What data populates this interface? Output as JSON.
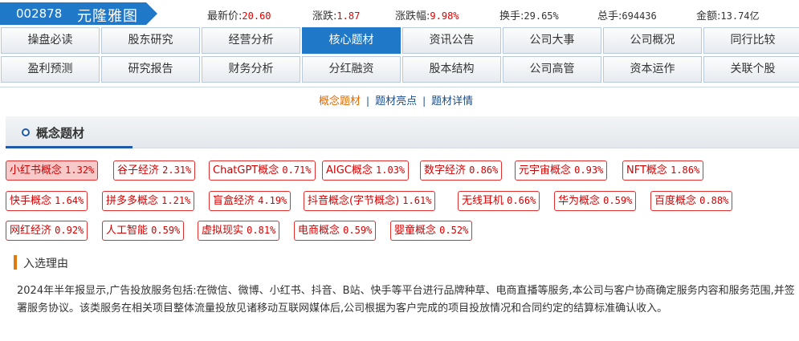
{
  "header": {
    "stock_code": "002878",
    "stock_name": "元隆雅图",
    "quotes": [
      {
        "label": "最新价:",
        "value": "20.60",
        "red": true
      },
      {
        "label": "涨跌:",
        "value": "1.87",
        "red": true
      },
      {
        "label": "涨跌幅:",
        "value": "9.98%",
        "red": true
      },
      {
        "label": "换手:",
        "value": "29.65%",
        "red": false
      },
      {
        "label": "总手:",
        "value": "694436",
        "red": false
      },
      {
        "label": "金额:",
        "value": "13.74亿",
        "red": false
      }
    ]
  },
  "nav": {
    "row1": [
      "操盘必读",
      "股东研究",
      "经营分析",
      "核心题材",
      "资讯公告",
      "公司大事",
      "公司概况",
      "同行比较"
    ],
    "row2": [
      "盈利预测",
      "研究报告",
      "财务分析",
      "分红融资",
      "股本结构",
      "公司高管",
      "资本运作",
      "关联个股"
    ],
    "active": "核心题材"
  },
  "subtabs": [
    "概念题材",
    "题材亮点",
    "题材详情"
  ],
  "subtab_sep": "|",
  "section": {
    "title": "概念题材"
  },
  "tags": [
    {
      "name": "小红书概念",
      "value": "1.32%",
      "active": true
    },
    {
      "name": "谷子经济",
      "value": "2.31%"
    },
    {
      "name": "ChatGPT概念",
      "value": "0.71%"
    },
    {
      "name": "AIGC概念",
      "value": "1.03%"
    },
    {
      "name": "数字经济",
      "value": "0.86%"
    },
    {
      "name": "元宇宙概念",
      "value": "0.93%"
    },
    {
      "name": "NFT概念",
      "value": "1.86%"
    },
    {
      "name": "快手概念",
      "value": "1.64%"
    },
    {
      "name": "拼多多概念",
      "value": "1.21%"
    },
    {
      "name": "盲盒经济",
      "value": "4.19%"
    },
    {
      "name": "抖音概念(字节概念)",
      "value": "1.61%"
    },
    {
      "name": "无线耳机",
      "value": "0.66%"
    },
    {
      "name": "华为概念",
      "value": "0.59%"
    },
    {
      "name": "百度概念",
      "value": "0.88%"
    },
    {
      "name": "网红经济",
      "value": "0.92%"
    },
    {
      "name": "人工智能",
      "value": "0.59%"
    },
    {
      "name": "虚拟现实",
      "value": "0.81%"
    },
    {
      "name": "电商概念",
      "value": "0.59%"
    },
    {
      "name": "婴童概念",
      "value": "0.52%"
    }
  ],
  "reason": {
    "title": "入选理由",
    "text": "2024年半年报显示,广告投放服务包括:在微信、微博、小红书、抖音、B站、快手等平台进行品牌种草、电商直播等服务,本公司与客户协商确定服务内容和服务范围,并签署服务协议。该类服务在相关项目整体流量投放见诸移动互联网媒体后,公司根据为客户完成的项目投放情况和合同约定的结算标准确认收入。"
  },
  "colors": {
    "brand_blue": "#1f78c8",
    "up_red": "#e10000",
    "tag_border": "#e03030",
    "accent_orange": "#e07a10"
  }
}
